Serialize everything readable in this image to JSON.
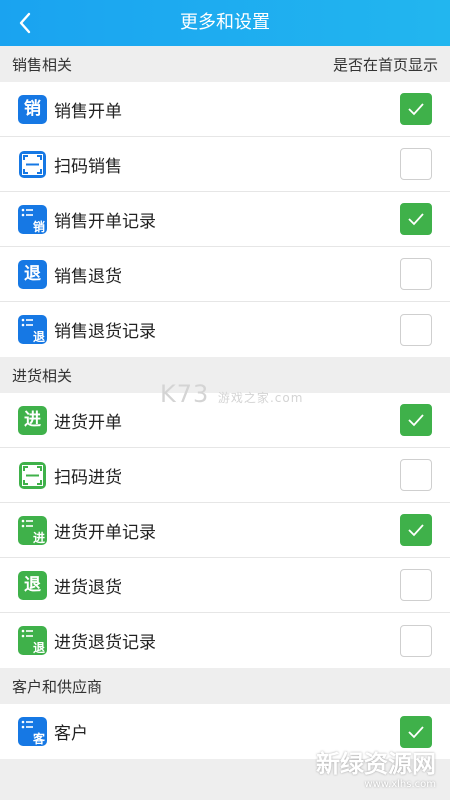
{
  "header": {
    "title": "更多和设置",
    "back_icon": "chevron-left-icon"
  },
  "colors": {
    "header": "#1aa3f0",
    "blue_icon": "#1678e4",
    "green": "#3fb14a"
  },
  "sections": [
    {
      "title": "销售相关",
      "hint": "是否在首页显示",
      "items": [
        {
          "label": "销售开单",
          "icon": "sales-icon",
          "glyph": "销",
          "checked": true
        },
        {
          "label": "扫码销售",
          "icon": "scan-icon",
          "glyph": "",
          "checked": false
        },
        {
          "label": "销售开单记录",
          "icon": "sales-record-icon",
          "glyph": "销",
          "checked": true
        },
        {
          "label": "销售退货",
          "icon": "return-icon",
          "glyph": "退",
          "checked": false
        },
        {
          "label": "销售退货记录",
          "icon": "return-record-icon",
          "glyph": "退",
          "checked": false
        }
      ]
    },
    {
      "title": "进货相关",
      "hint": "",
      "items": [
        {
          "label": "进货开单",
          "icon": "purchase-icon",
          "glyph": "进",
          "checked": true
        },
        {
          "label": "扫码进货",
          "icon": "scan-icon",
          "glyph": "",
          "checked": false
        },
        {
          "label": "进货开单记录",
          "icon": "purchase-record-icon",
          "glyph": "进",
          "checked": true
        },
        {
          "label": "进货退货",
          "icon": "return-icon",
          "glyph": "退",
          "checked": false
        },
        {
          "label": "进货退货记录",
          "icon": "return-record-icon",
          "glyph": "退",
          "checked": false
        }
      ]
    },
    {
      "title": "客户和供应商",
      "hint": "",
      "items": [
        {
          "label": "客户",
          "icon": "customer-icon",
          "glyph": "客",
          "checked": true
        }
      ]
    }
  ],
  "watermark": {
    "main": "K73",
    "sub": "游戏之家",
    "domain": ".com"
  },
  "brand": {
    "name": "新绿资源网",
    "url": "www.xlhs.com"
  }
}
